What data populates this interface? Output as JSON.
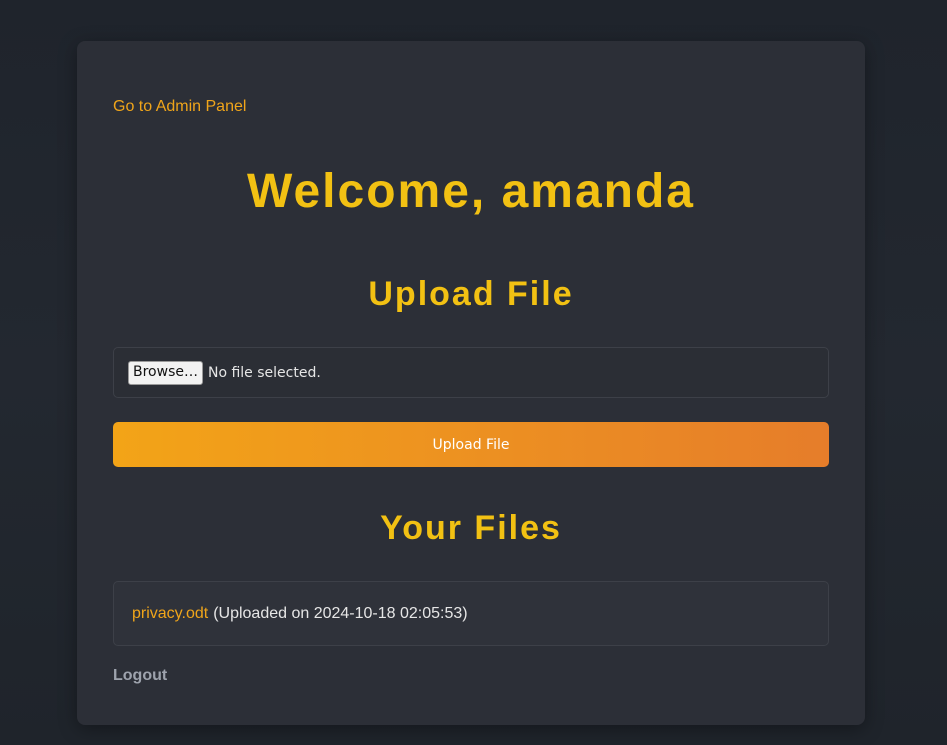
{
  "nav": {
    "admin_link": "Go to Admin Panel"
  },
  "welcome": {
    "title": "Welcome, amanda"
  },
  "upload": {
    "title": "Upload File",
    "browse_label": "Browse…",
    "file_status": "No file selected.",
    "submit_label": "Upload File"
  },
  "files": {
    "title": "Your Files",
    "items": [
      {
        "name": "privacy.odt",
        "meta": "(Uploaded on 2024-10-18 02:05:53)"
      }
    ]
  },
  "footer": {
    "logout_label": "Logout"
  },
  "colors": {
    "accent": "#f2c113",
    "link": "#f0a51a",
    "button_gradient_start": "#f3a417",
    "button_gradient_end": "#e67d2a",
    "card_bg": "#2c2f37"
  }
}
